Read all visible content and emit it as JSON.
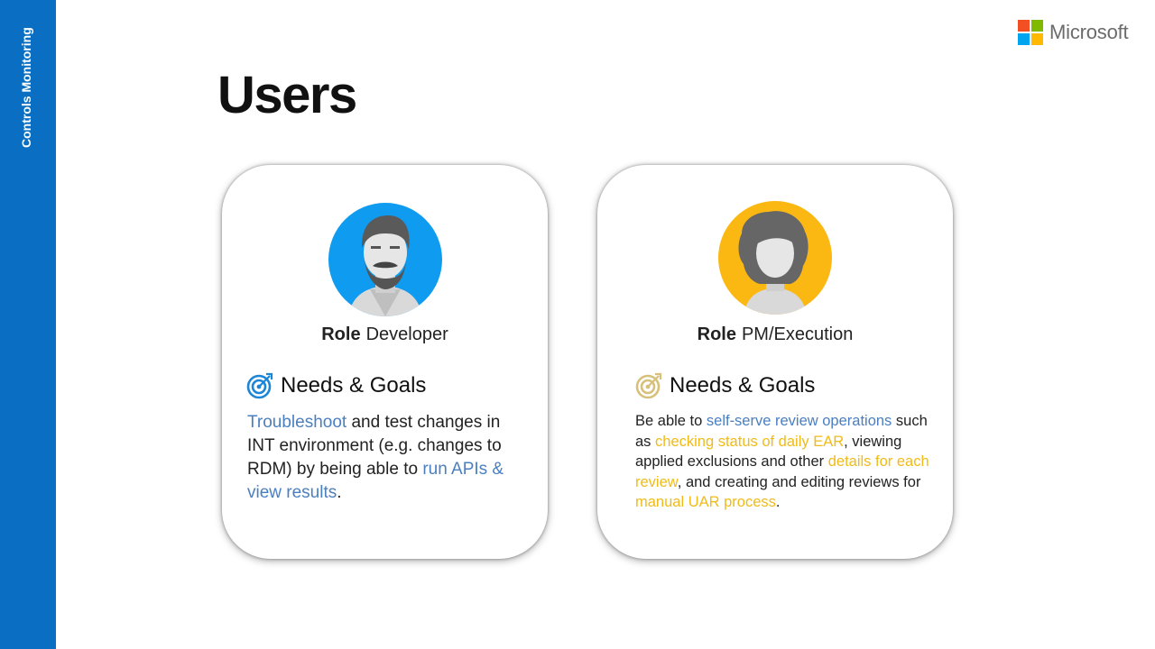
{
  "sidebar": {
    "label": "Controls Monitoring"
  },
  "brand": {
    "name": "Microsoft",
    "logo_colors": [
      "#f25022",
      "#7fba00",
      "#00a4ef",
      "#ffb900"
    ]
  },
  "page": {
    "title": "Users"
  },
  "colors": {
    "sidebar": "#0a6fc2",
    "blue_highlight": "#4a7fc1",
    "yellow_highlight": "#f0bb18",
    "dev_avatar_bg": "#0f9cf0",
    "pm_avatar_bg": "#fbb813"
  },
  "cards": [
    {
      "role_key": "Role",
      "role_value": "Developer",
      "needs_title": "Needs & Goals",
      "needs_icon": "target-icon",
      "description": [
        {
          "text": "Troubleshoot",
          "hl": "blue"
        },
        {
          "text": " and test changes in INT environment (e.g. changes to RDM) by being able to ",
          "hl": ""
        },
        {
          "text": "run APIs & view results",
          "hl": "blue"
        },
        {
          "text": ".",
          "hl": ""
        }
      ]
    },
    {
      "role_key": "Role",
      "role_value": "PM/Execution",
      "needs_title": "Needs & Goals",
      "needs_icon": "target-icon",
      "description": [
        {
          "text": "Be able to ",
          "hl": ""
        },
        {
          "text": "self-serve review operations",
          "hl": "blue"
        },
        {
          "text": " such as ",
          "hl": ""
        },
        {
          "text": "checking status of daily EAR",
          "hl": "yellow"
        },
        {
          "text": ", viewing applied exclusions and other ",
          "hl": ""
        },
        {
          "text": "details for each review",
          "hl": "yellow"
        },
        {
          "text": ", and creating and editing reviews for ",
          "hl": ""
        },
        {
          "text": "manual UAR process",
          "hl": "yellow"
        },
        {
          "text": ".",
          "hl": ""
        }
      ]
    }
  ]
}
